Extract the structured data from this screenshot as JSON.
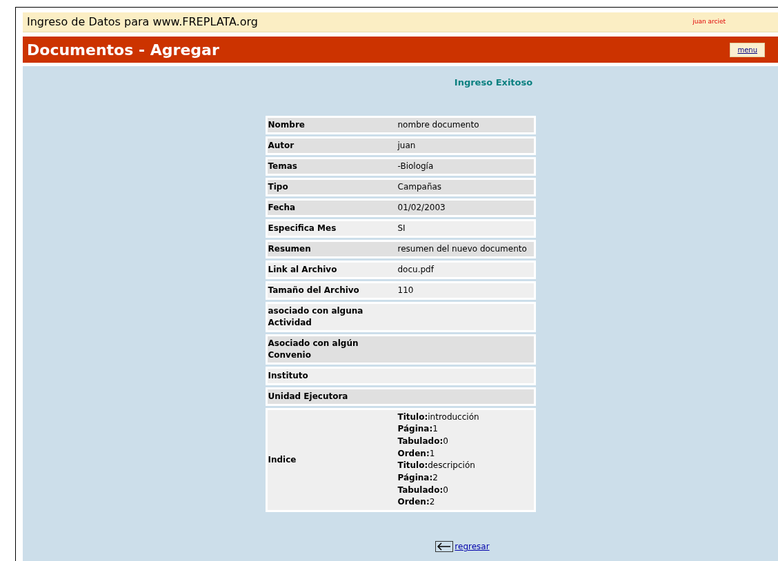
{
  "header": {
    "title": "Ingreso de Datos para www.FREPLATA.org",
    "user": "juan arciet"
  },
  "title_bar": {
    "title": "Documentos - Agregar",
    "menu_button": "menu"
  },
  "message": "Ingreso Exitoso",
  "rows": [
    {
      "label": "Nombre",
      "value": "nombre documento",
      "shaded": true
    },
    {
      "label": "Autor",
      "value": "juan",
      "shaded": true
    },
    {
      "label": "Temas",
      "value": "-Biología",
      "shaded": true
    },
    {
      "label": "Tipo",
      "value": "Campañas",
      "shaded": true
    },
    {
      "label": "Fecha",
      "value": "01/02/2003",
      "shaded": true
    },
    {
      "label": "Especifica Mes",
      "value": "SI",
      "shaded": false
    },
    {
      "label": "Resumen",
      "value": "resumen del nuevo documento",
      "shaded": true
    },
    {
      "label": "Link al Archivo",
      "value": "docu.pdf",
      "shaded": false
    },
    {
      "label": "Tamaño del Archivo",
      "value": "110",
      "shaded": false
    },
    {
      "label": "asociado con alguna Actividad",
      "shaded": false
    },
    {
      "label": "Asociado con algún Convenio",
      "shaded": true
    },
    {
      "label": "Instituto",
      "shaded": false
    },
    {
      "label": "Unidad Ejecutora",
      "shaded": true
    },
    {
      "label": "Indice",
      "shaded": false,
      "lines": [
        "**Titulo:**introducción",
        "**Página:**1",
        "**Tabulado:**0",
        "**Orden:**1",
        "**Titulo:**descripción",
        "**Página:**2",
        "**Tabulado:**0",
        "**Orden:**2"
      ]
    }
  ],
  "back_link": "regresar"
}
